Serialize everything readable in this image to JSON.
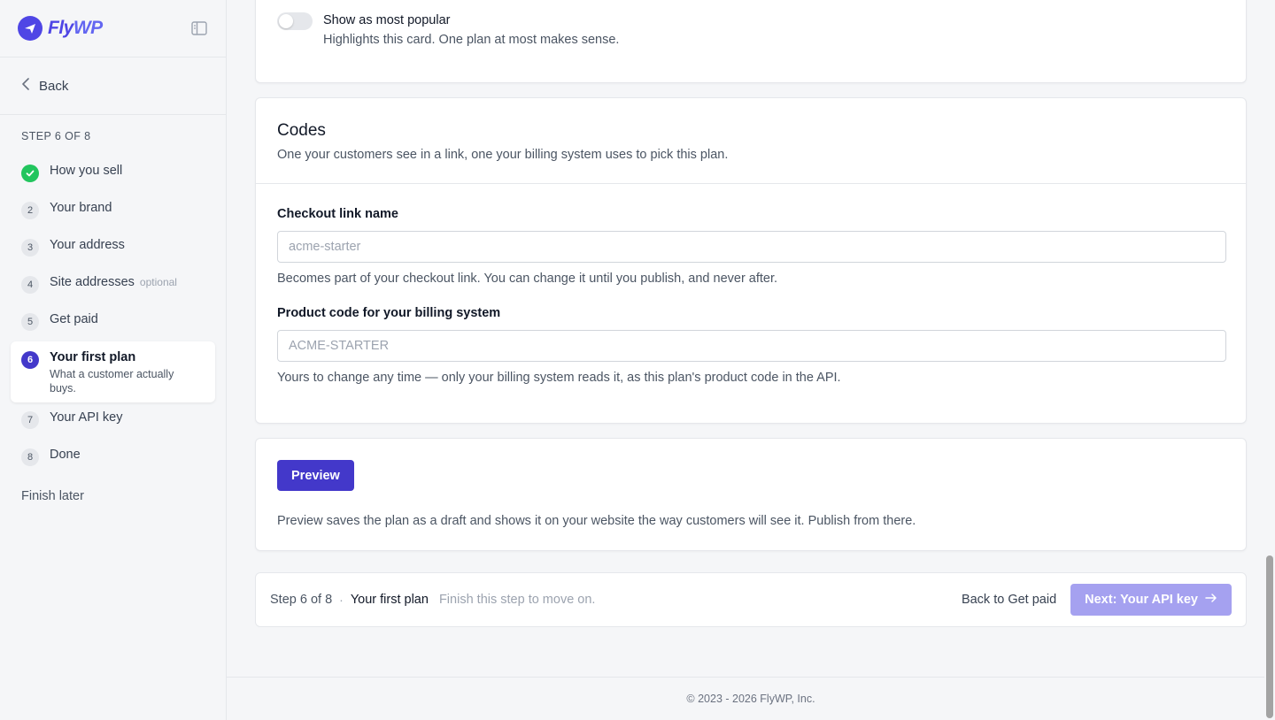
{
  "brand": {
    "name_fly": "Fly",
    "name_wp": "WP"
  },
  "sidebar": {
    "back_label": "Back",
    "step_label": "STEP 6 OF 8",
    "steps": [
      {
        "num": "",
        "title": "How you sell",
        "status": "done"
      },
      {
        "num": "2",
        "title": "Your brand"
      },
      {
        "num": "3",
        "title": "Your address"
      },
      {
        "num": "4",
        "title": "Site addresses",
        "optional": "optional"
      },
      {
        "num": "5",
        "title": "Get paid"
      },
      {
        "num": "6",
        "title": "Your first plan",
        "subtitle": "What a customer actually buys.",
        "status": "active"
      },
      {
        "num": "7",
        "title": "Your API key"
      },
      {
        "num": "8",
        "title": "Done"
      }
    ],
    "finish_later": "Finish later"
  },
  "popular": {
    "title": "Show as most popular",
    "description": "Highlights this card. One plan at most makes sense.",
    "enabled": false
  },
  "codes": {
    "title": "Codes",
    "description": "One your customers see in a link, one your billing system uses to pick this plan.",
    "checkout": {
      "label": "Checkout link name",
      "placeholder": "acme-starter",
      "help": "Becomes part of your checkout link. You can change it until you publish, and never after."
    },
    "product": {
      "label": "Product code for your billing system",
      "placeholder": "ACME-STARTER",
      "help": "Yours to change any time — only your billing system reads it, as this plan's product code in the API."
    }
  },
  "preview": {
    "button": "Preview",
    "note": "Preview saves the plan as a draft and shows it on your website the way customers will see it. Publish from there."
  },
  "footer_bar": {
    "step": "Step 6 of 8",
    "separator": "·",
    "current": "Your first plan",
    "hint": "Finish this step to move on.",
    "back": "Back to Get paid",
    "next": "Next: Your API key"
  },
  "copyright": "© 2023 - 2026 FlyWP, Inc.",
  "colors": {
    "accent": "#4338ca",
    "success": "#22c55e",
    "next_disabled": "#a5a1f0"
  }
}
